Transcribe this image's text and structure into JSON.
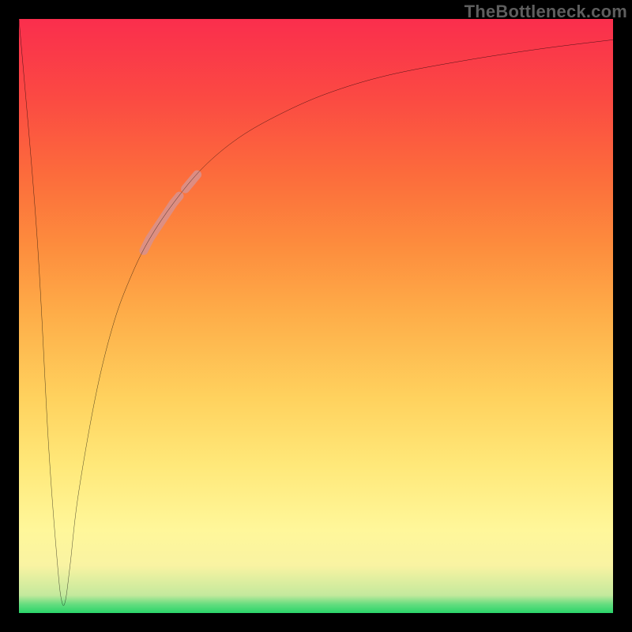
{
  "watermark": "TheBottleneck.com",
  "chart_data": {
    "type": "line",
    "title": "",
    "xlabel": "",
    "ylabel": "",
    "xlim": [
      0,
      100
    ],
    "ylim": [
      0,
      100
    ],
    "grid": false,
    "legend": false,
    "series": [
      {
        "name": "bottleneck-curve",
        "color": "#000000",
        "x": [
          0,
          3,
          5,
          6.5,
          7.2,
          7.8,
          8.6,
          10,
          13,
          16,
          19,
          22,
          26,
          31,
          37,
          44,
          52,
          62,
          75,
          88,
          100
        ],
        "values": [
          100,
          64,
          28,
          8,
          2,
          2,
          8,
          20,
          37,
          49,
          57,
          63,
          69,
          75,
          80,
          84,
          87.5,
          90.5,
          93,
          95,
          96.5
        ]
      }
    ],
    "highlights": [
      {
        "name": "segment-main",
        "color": "#d99089",
        "width": 11,
        "x_start": 21,
        "x_end": 27
      },
      {
        "name": "segment-dot",
        "color": "#d99089",
        "width": 11,
        "x_start": 28,
        "x_end": 30
      }
    ],
    "gradient_stops": [
      {
        "pct": 0,
        "color": "#2ad46a"
      },
      {
        "pct": 1.5,
        "color": "#66dd7f"
      },
      {
        "pct": 3,
        "color": "#c4e99d"
      },
      {
        "pct": 8,
        "color": "#f9f3a2"
      },
      {
        "pct": 14,
        "color": "#fff79a"
      },
      {
        "pct": 25,
        "color": "#ffe879"
      },
      {
        "pct": 36,
        "color": "#ffd25e"
      },
      {
        "pct": 50,
        "color": "#feae49"
      },
      {
        "pct": 62,
        "color": "#fd8c3d"
      },
      {
        "pct": 74,
        "color": "#fc6b3c"
      },
      {
        "pct": 87,
        "color": "#fb4943"
      },
      {
        "pct": 100,
        "color": "#fa2e4d"
      }
    ]
  }
}
